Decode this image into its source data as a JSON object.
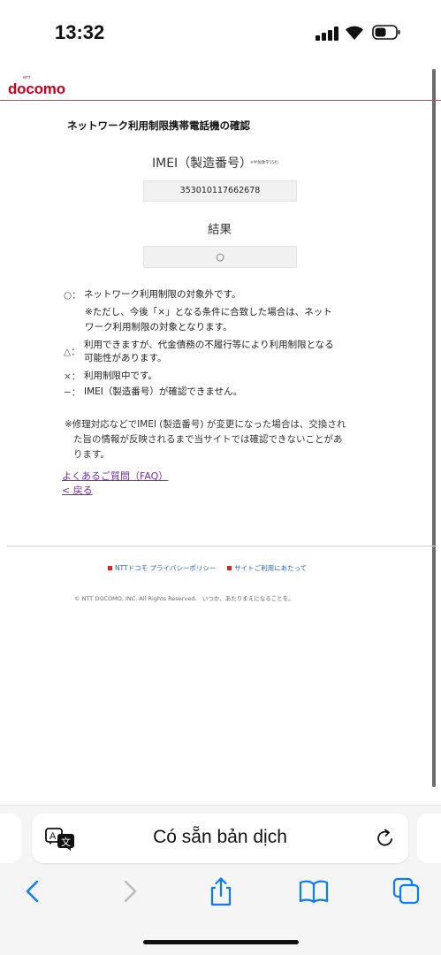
{
  "status_bar": {
    "time": "13:32"
  },
  "header": {
    "logo_small": "NTT",
    "logo": "docomo"
  },
  "page": {
    "title": "ネットワーク利用制限携帯電話機の確認",
    "imei_label": "IMEI（製造番号）",
    "imei_note": "※半角数字15桁",
    "imei_value": "353010117662678",
    "result_label": "結果",
    "result_value": "○"
  },
  "legend": [
    {
      "symbol": "○：",
      "lines": [
        "ネットワーク利用制限の対象外です。",
        "※ただし、今後「×」となる条件に合致した場合は、ネット",
        "ワーク利用制限の対象となります。"
      ]
    },
    {
      "symbol": "△：",
      "lines": [
        "利用できますが、代金債務の不履行等により利用制限となる",
        "可能性があります。"
      ]
    },
    {
      "symbol": "×：",
      "lines": [
        "利用制限中です。"
      ]
    },
    {
      "symbol": "−：",
      "lines": [
        "IMEI（製造番号）が確認できません。"
      ]
    }
  ],
  "note": {
    "lines": [
      "※修理対応などでIMEI (製造番号) が変更になった場合は、交換され",
      "た旨の情報が反映されるまで当サイトでは確認できないことがあ",
      "ります。"
    ]
  },
  "links": {
    "faq": "よくあるご質問（FAQ）",
    "back": "< 戻る"
  },
  "footer": {
    "privacy": "NTTドコモ プライバシーポリシー",
    "terms": "サイトご利用にあたって",
    "copyright": "© NTT DOCOMO, INC. All Rights Reserved.　いつか、あたりまえになることを。"
  },
  "browser": {
    "translation_banner": "Có sẵn bản dịch"
  },
  "colors": {
    "brand": "#c8001e",
    "link": "#6f2da8",
    "footer_link": "#1f63c4",
    "safari_blue": "#0a7aff"
  }
}
